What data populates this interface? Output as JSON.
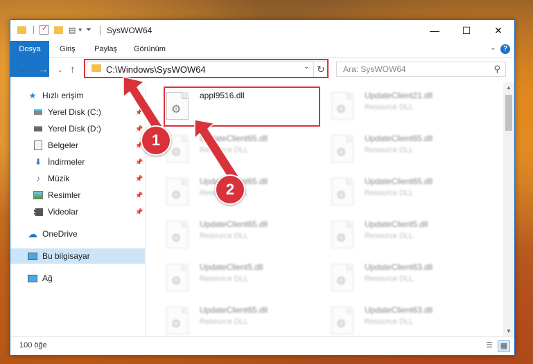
{
  "window": {
    "title": "SysWOW64",
    "controls": {
      "minimize": "—",
      "maximize": "☐",
      "close": "✕"
    }
  },
  "ribbon": {
    "tabs": [
      "Dosya",
      "Giriş",
      "Paylaş",
      "Görünüm"
    ],
    "help": "?"
  },
  "address": {
    "path": "C:\\Windows\\SysWOW64",
    "search_placeholder": "Ara: SysWOW64"
  },
  "sidebar": {
    "items": [
      {
        "label": "Hızlı erişim",
        "icon": "star-icon"
      },
      {
        "label": "Yerel Disk (C:)",
        "icon": "drive-icon",
        "pinned": true
      },
      {
        "label": "Yerel Disk (D:)",
        "icon": "drive-icon",
        "pinned": true
      },
      {
        "label": "Belgeler",
        "icon": "documents-icon",
        "pinned": true
      },
      {
        "label": "İndirmeler",
        "icon": "download-icon",
        "pinned": true
      },
      {
        "label": "Müzik",
        "icon": "music-icon",
        "pinned": true
      },
      {
        "label": "Resimler",
        "icon": "pictures-icon",
        "pinned": true
      },
      {
        "label": "Videolar",
        "icon": "video-icon",
        "pinned": true
      },
      {
        "label": "OneDrive",
        "icon": "cloud-icon"
      },
      {
        "label": "Bu bilgisayar",
        "icon": "computer-icon",
        "selected": true
      },
      {
        "label": "Ağ",
        "icon": "network-icon"
      }
    ]
  },
  "files": [
    {
      "name": "appl9516.dll",
      "desc": "",
      "highlight": true
    },
    {
      "name": "UpdateClient21.dll",
      "desc": "Resource DLL"
    },
    {
      "name": "UpdateClient65.dll",
      "desc": "Resource DLL"
    },
    {
      "name": "UpdateClient65.dll",
      "desc": "Resource DLL"
    },
    {
      "name": "UpdateClient65.dll",
      "desc": "Resource DLL"
    },
    {
      "name": "UpdateClient65.dll",
      "desc": "Resource DLL"
    },
    {
      "name": "UpdateClient65.dll",
      "desc": "Resource DLL"
    },
    {
      "name": "UpdateClient5.dll",
      "desc": "Resource DLL"
    },
    {
      "name": "UpdateClient5.dll",
      "desc": "Resource DLL"
    },
    {
      "name": "UpdateClient63.dll",
      "desc": "Resource DLL"
    },
    {
      "name": "UpdateClient65.dll",
      "desc": "Resource DLL"
    },
    {
      "name": "UpdateClient63.dll",
      "desc": "Resource DLL"
    }
  ],
  "status": {
    "count": "100 öğe"
  },
  "annotations": {
    "step1": "1",
    "step2": "2",
    "color": "#d8333b"
  }
}
